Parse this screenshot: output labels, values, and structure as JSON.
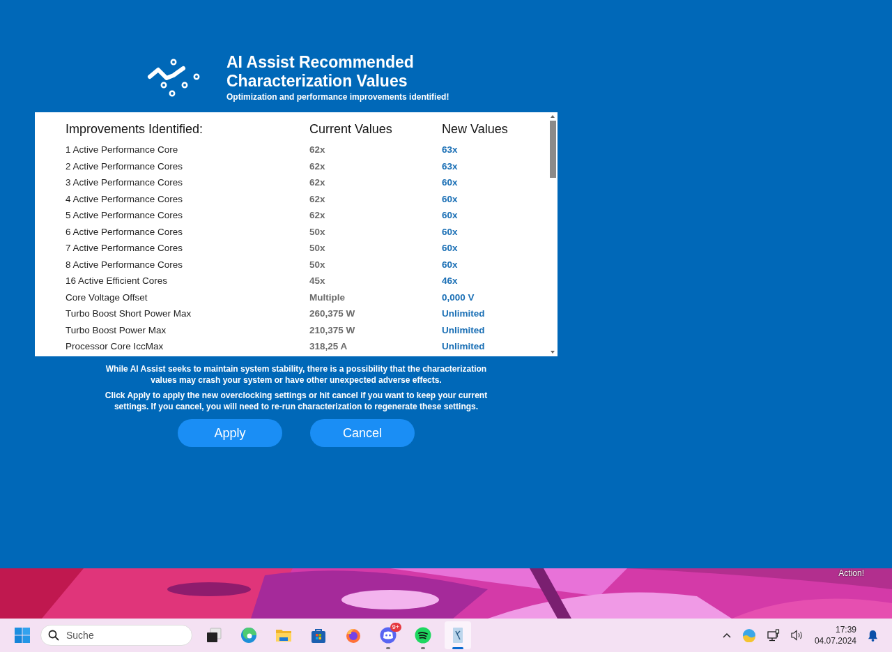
{
  "header": {
    "title": "AI Assist Recommended Characterization Values",
    "subtitle": "Optimization and performance improvements identified!"
  },
  "table": {
    "columns": [
      "Improvements Identified:",
      "Current Values",
      "New Values"
    ],
    "rows": [
      {
        "name": "1 Active Performance Core",
        "current": "62x",
        "new": "63x"
      },
      {
        "name": "2 Active Performance Cores",
        "current": "62x",
        "new": "63x"
      },
      {
        "name": "3 Active Performance Cores",
        "current": "62x",
        "new": "60x"
      },
      {
        "name": "4 Active Performance Cores",
        "current": "62x",
        "new": "60x"
      },
      {
        "name": "5 Active Performance Cores",
        "current": "62x",
        "new": "60x"
      },
      {
        "name": "6 Active Performance Cores",
        "current": "50x",
        "new": "60x"
      },
      {
        "name": "7 Active Performance Cores",
        "current": "50x",
        "new": "60x"
      },
      {
        "name": "8 Active Performance Cores",
        "current": "50x",
        "new": "60x"
      },
      {
        "name": "16 Active Efficient Cores",
        "current": "45x",
        "new": "46x"
      },
      {
        "name": "Core Voltage Offset",
        "current": "Multiple",
        "new": "0,000 V"
      },
      {
        "name": "Turbo Boost Short Power Max",
        "current": "260,375 W",
        "new": "Unlimited"
      },
      {
        "name": "Turbo Boost Power Max",
        "current": "210,375 W",
        "new": "Unlimited"
      },
      {
        "name": "Processor Core IccMax",
        "current": "318,25 A",
        "new": "Unlimited"
      }
    ]
  },
  "notes": [
    "While AI Assist seeks to maintain system stability, there is a possibility that the characterization values may crash your system or have other unexpected adverse effects.",
    "Click Apply to apply the new overclocking settings or hit cancel if you want to keep your current settings. If you cancel, you will need to re-run characterization to regenerate these settings."
  ],
  "buttons": [
    "Apply",
    "Cancel"
  ],
  "overlay_label": "Action!",
  "taskbar": {
    "search": {
      "placeholder": "Suche"
    },
    "apps": [
      {
        "running": false,
        "selected": false
      },
      {
        "running": false,
        "selected": false
      },
      {
        "running": false,
        "selected": false
      },
      {
        "running": false,
        "selected": false
      },
      {
        "running": false,
        "selected": false
      },
      {
        "running": true,
        "selected": false,
        "badge": "9+"
      },
      {
        "running": true,
        "selected": false
      },
      {
        "running": true,
        "selected": true
      }
    ],
    "time": "17:39",
    "date": "04.07.2024"
  }
}
